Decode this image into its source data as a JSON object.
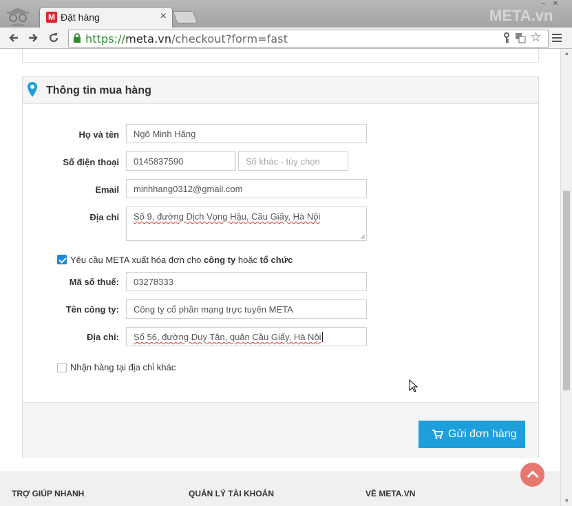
{
  "browser": {
    "tab_title": "Đặt hàng",
    "tab_favicon_letter": "M",
    "close_glyph": "×",
    "watermark": "META.vn",
    "url": {
      "scheme": "https://",
      "host": "meta.vn",
      "path": "/checkout?form=fast"
    }
  },
  "form": {
    "title": "Thông tin mua hàng",
    "fullname": {
      "label": "Họ và tên",
      "value": "Ngô Minh Hăng"
    },
    "phone": {
      "label": "Số điện thoại",
      "value": "0145837590",
      "alt_placeholder": "Số khác - tùy chọn"
    },
    "email": {
      "label": "Email",
      "value": "minhhang0312@gmail.com"
    },
    "address": {
      "label": "Địa chỉ",
      "value": "Số 9, đường Dịch Vọng Hậu, Cầu Giấy, Hà Nội"
    },
    "invoice": {
      "checked": true,
      "label_prefix": "Yêu cầu META xuất hóa đơn cho ",
      "label_company": "công ty",
      "label_mid": " hoặc ",
      "label_org": "tổ chức"
    },
    "tax_code": {
      "label": "Mã số thuế:",
      "value": "03278333"
    },
    "company": {
      "label": "Tên công ty:",
      "value": "Công ty cổ phần mạng trực tuyến META"
    },
    "company_address": {
      "label": "Địa chỉ:",
      "value": "Số 56, đường Duy Tân, quân Cầu Giấy, Hà Nội"
    },
    "other_address": {
      "checked": false,
      "label": "Nhận hàng tại địa chỉ khác"
    },
    "submit_label": "Gửi đơn hàng"
  },
  "footer": {
    "columns": [
      "TRỢ GIÚP NHANH",
      "QUẢN LÝ TÀI KHOẢN",
      "VỀ META.VN"
    ]
  },
  "colors": {
    "accent": "#1d9fdc",
    "checkbox": "#1e88d8",
    "back_to_top": "#e8776e",
    "secure_scheme": "#2c8a2c"
  },
  "icons": [
    "incognito-icon",
    "close-icon",
    "back-icon",
    "forward-icon",
    "reload-icon",
    "lock-icon",
    "key-icon",
    "translate-icon",
    "star-icon",
    "menu-icon",
    "map-pin-icon",
    "cart-icon",
    "chevron-up-icon",
    "cursor-icon"
  ]
}
